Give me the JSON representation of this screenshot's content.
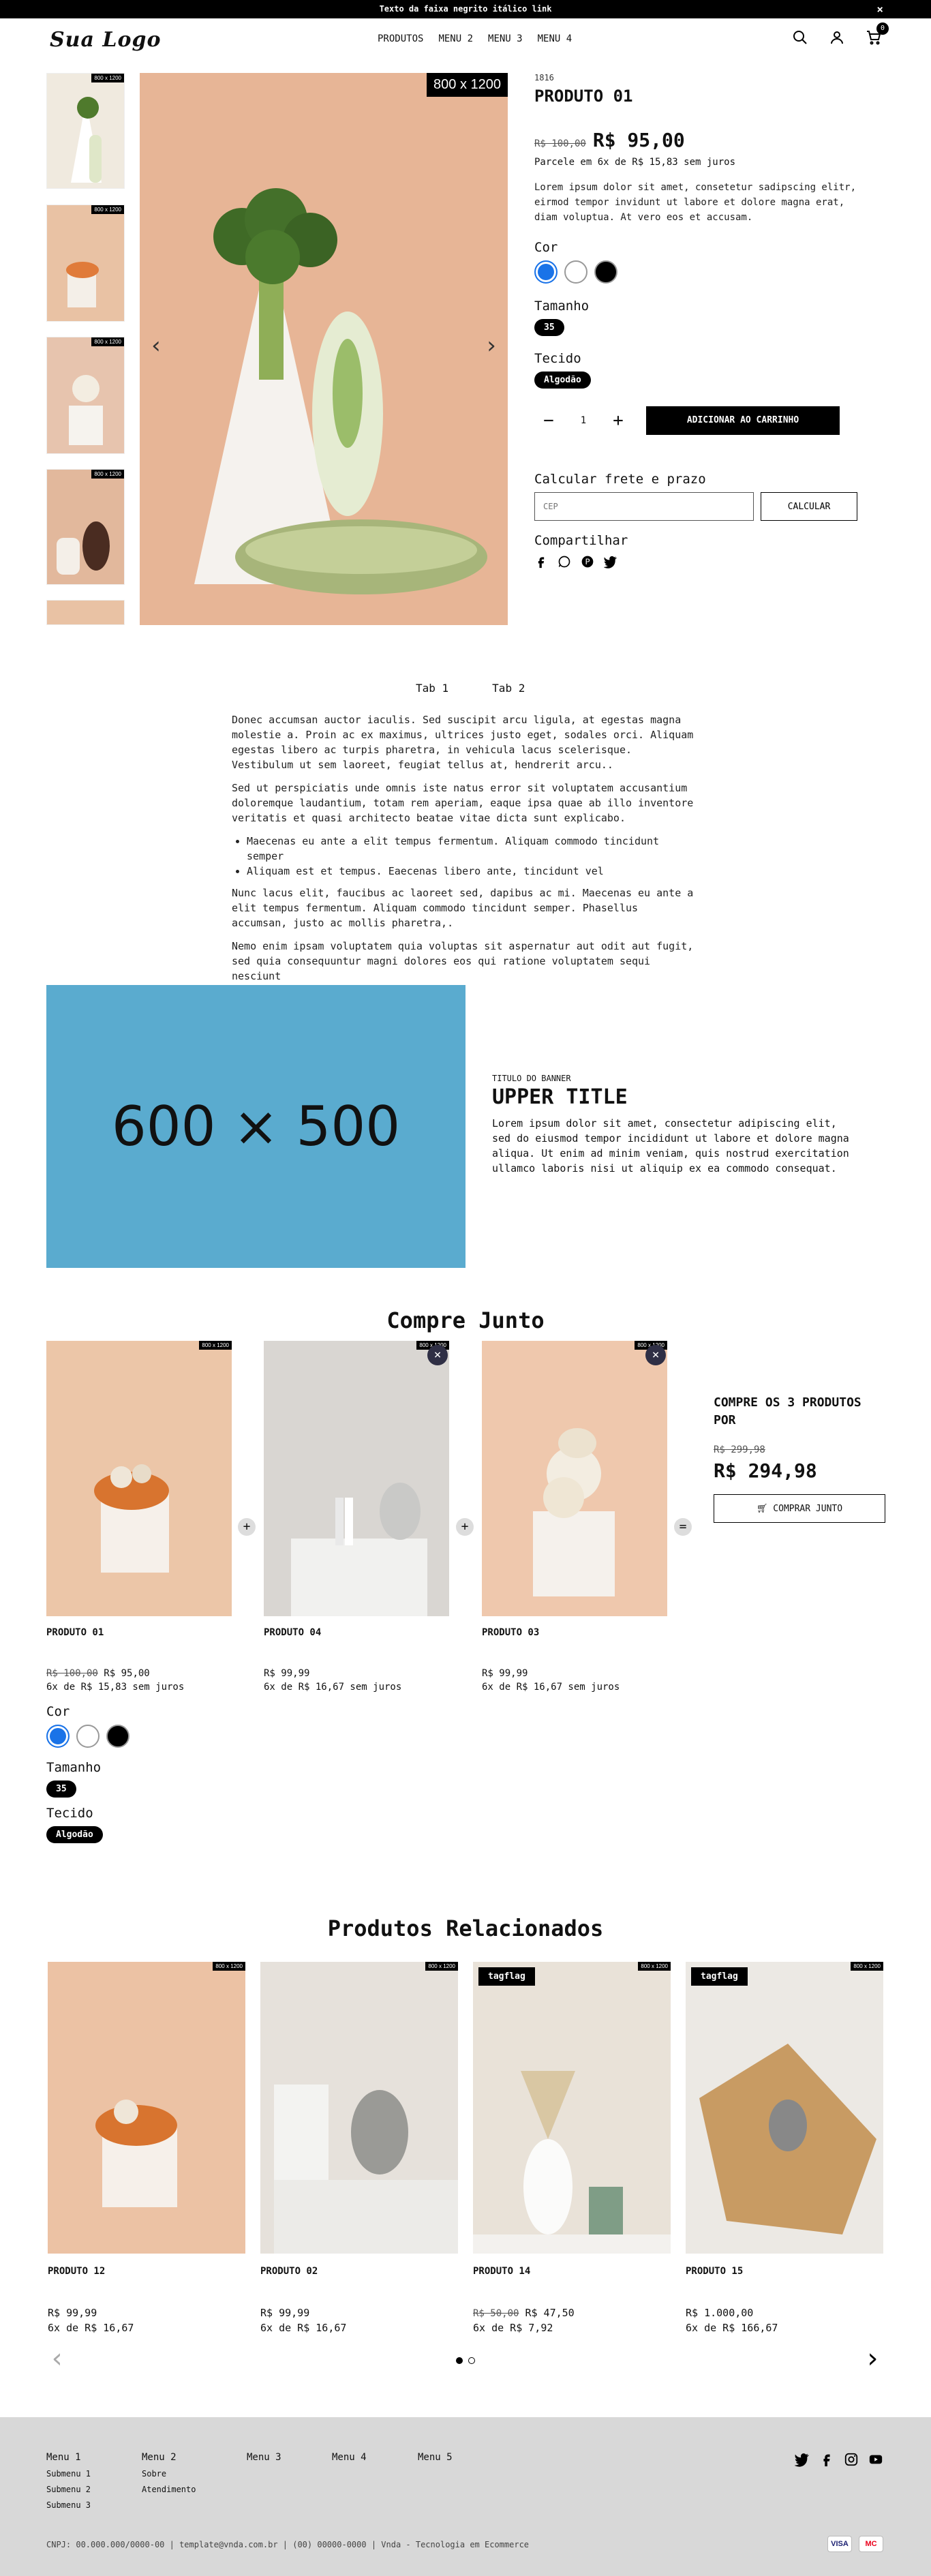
{
  "topbar": {
    "text": "Texto da faixa negrito itálico link",
    "close": "×"
  },
  "header": {
    "logo": "Sua Logo",
    "nav": [
      "PRODUTOS",
      "MENU 2",
      "MENU 3",
      "MENU 4"
    ],
    "cart_count": "0",
    "icons": [
      "search-icon",
      "user-icon",
      "cart-icon"
    ]
  },
  "gallery": {
    "placeholder_main": "800 x 1200",
    "placeholder_thumb": "800 x 1200"
  },
  "product": {
    "sku": "1816",
    "name": "PRODUTO 01",
    "old_price": "R$ 100,00",
    "price": "R$ 95,00",
    "installments": "Parcele em 6x de R$ 15,83 sem juros",
    "description": "Lorem ipsum dolor sit amet, consetetur sadipscing elitr, eirmod tempor invidunt ut labore et dolore magna erat, diam voluptua. At vero eos et accusam.",
    "color_label": "Cor",
    "colors": [
      "#1a73e8",
      "#ffffff",
      "#000000"
    ],
    "size_label": "Tamanho",
    "size_value": "35",
    "fabric_label": "Tecido",
    "fabric_value": "Algodão",
    "qty_minus": "−",
    "qty_value": "1",
    "qty_plus": "+",
    "add_to_cart": "ADICIONAR AO CARRINHO",
    "shipping_label": "Calcular frete e prazo",
    "cep_placeholder": "CEP",
    "calc_button": "CALCULAR",
    "share_label": "Compartilhar"
  },
  "tabs": {
    "items": [
      "Tab 1",
      "Tab 2"
    ],
    "p1": "Donec accumsan auctor iaculis. Sed suscipit arcu ligula, at egestas magna molestie a. Proin ac ex maximus, ultrices justo eget, sodales orci. Aliquam egestas libero ac turpis pharetra, in vehicula lacus scelerisque. Vestibulum ut sem laoreet, feugiat tellus at, hendrerit arcu..",
    "p2": "Sed ut perspiciatis unde omnis iste natus error sit voluptatem accusantium doloremque laudantium, totam rem aperiam, eaque ipsa quae ab illo inventore veritatis et quasi architecto beatae vitae dicta sunt explicabo.",
    "li1": "Maecenas eu ante a elit tempus fermentum. Aliquam commodo tincidunt semper",
    "li2": "Aliquam est et tempus. Eaecenas libero ante, tincidunt vel",
    "p3": "Nunc lacus elit, faucibus ac laoreet sed, dapibus ac mi. Maecenas eu ante a elit tempus fermentum. Aliquam commodo tincidunt semper. Phasellus accumsan, justo ac mollis pharetra,.",
    "p4": "Nemo enim ipsam voluptatem quia voluptas sit aspernatur aut odit aut fugit, sed quia consequuntur magni dolores eos qui ratione voluptatem sequi nesciunt"
  },
  "banner": {
    "image_label": "600 × 500",
    "subtitle": "TITULO DO BANNER",
    "title": "UPPER TITLE",
    "text": "Lorem ipsum dolor sit amet, consectetur adipiscing elit, sed do eiusmod tempor incididunt ut labore et dolore magna aliqua. Ut enim ad minim veniam, quis nostrud exercitation ullamco laboris nisi ut aliquip ex ea commodo consequat."
  },
  "compre_junto": {
    "title": "Compre Junto",
    "products": [
      {
        "name": "PRODUTO 01",
        "old_price": "R$ 100,00",
        "price": "R$ 95,00",
        "installments": "6x de R$ 15,83 sem juros",
        "placeholder": "800 x 1200"
      },
      {
        "name": "PRODUTO 04",
        "old_price": "",
        "price": "R$ 99,99",
        "installments": "6x de R$ 16,67 sem juros",
        "placeholder": "800 x 1200"
      },
      {
        "name": "PRODUTO 03",
        "old_price": "",
        "price": "R$ 99,99",
        "installments": "6x de R$ 16,67 sem juros",
        "placeholder": "800 x 1200"
      }
    ],
    "plus": "+",
    "equals": "=",
    "remove": "×",
    "box_title": "COMPRE OS 3 PRODUTOS POR",
    "box_old_price": "R$ 299,98",
    "box_price": "R$ 294,98",
    "box_button": "COMPRAR JUNTO",
    "color_label": "Cor",
    "colors": [
      "#1a73e8",
      "#ffffff",
      "#000000"
    ],
    "size_label": "Tamanho",
    "size_value": "35",
    "fabric_label": "Tecido",
    "fabric_value": "Algodão"
  },
  "related": {
    "title": "Produtos Relacionados",
    "products": [
      {
        "name": "PRODUTO 12",
        "old_price": "",
        "price": "R$ 99,99",
        "installments": "6x de R$ 16,67",
        "tag": "",
        "placeholder": "800 x 1200"
      },
      {
        "name": "PRODUTO 02",
        "old_price": "",
        "price": "R$ 99,99",
        "installments": "6x de R$ 16,67",
        "tag": "",
        "placeholder": "800 x 1200"
      },
      {
        "name": "PRODUTO 14",
        "old_price": "R$ 50,00",
        "price": "R$ 47,50",
        "installments": "6x de R$ 7,92",
        "tag": "tagflag",
        "placeholder": "800 x 1200"
      },
      {
        "name": "PRODUTO 15",
        "old_price": "",
        "price": "R$ 1.000,00",
        "installments": "6x de R$ 166,67",
        "tag": "tagflag",
        "placeholder": "800 x 1200"
      }
    ]
  },
  "footer": {
    "menus": [
      {
        "title": "Menu 1",
        "items": [
          "Submenu 1",
          "Submenu 2",
          "Submenu 3"
        ]
      },
      {
        "title": "Menu 2",
        "items": [
          "Sobre",
          "Atendimento"
        ]
      },
      {
        "title": "Menu 3",
        "items": []
      },
      {
        "title": "Menu 4",
        "items": []
      },
      {
        "title": "Menu 5",
        "items": []
      }
    ],
    "legal": "CNPJ: 00.000.000/0000-00 | template@vnda.com.br | (00) 00000-0000 | Vnda - Tecnologia em Ecommerce",
    "payments": [
      "VISA",
      "MC"
    ]
  }
}
